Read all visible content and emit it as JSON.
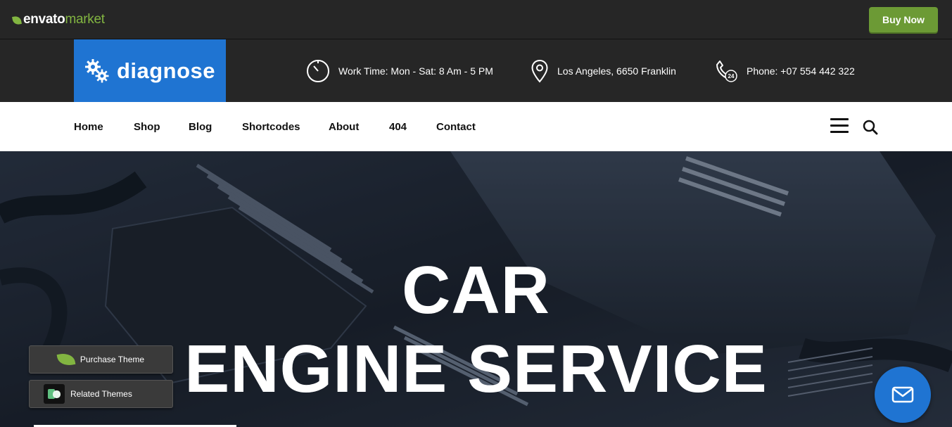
{
  "envato": {
    "logo_word1": "envato",
    "logo_word2": "market",
    "buy_now": "Buy Now",
    "brand_green": "#82b541"
  },
  "header": {
    "brand": "diagnose",
    "brand_color": "#1f74d2",
    "work_time": "Work Time: Mon - Sat: 8 Am - 5 PM",
    "location": "Los Angeles, 6650 Franklin",
    "phone": "Phone: +07 554 442 322",
    "icons": [
      "clock-icon",
      "map-pin-icon",
      "phone-24-icon"
    ]
  },
  "nav": {
    "items": [
      "Home",
      "Shop",
      "Blog",
      "Shortcodes",
      "About",
      "404",
      "Contact"
    ],
    "icons": [
      "hamburger-menu-icon",
      "search-icon"
    ]
  },
  "hero": {
    "line1": "CAR",
    "line2": "ENGINE SERVICE"
  },
  "floating": {
    "purchase_theme": "Purchase Theme",
    "related_themes": "Related Themes",
    "mail_icon": "mail-icon"
  }
}
